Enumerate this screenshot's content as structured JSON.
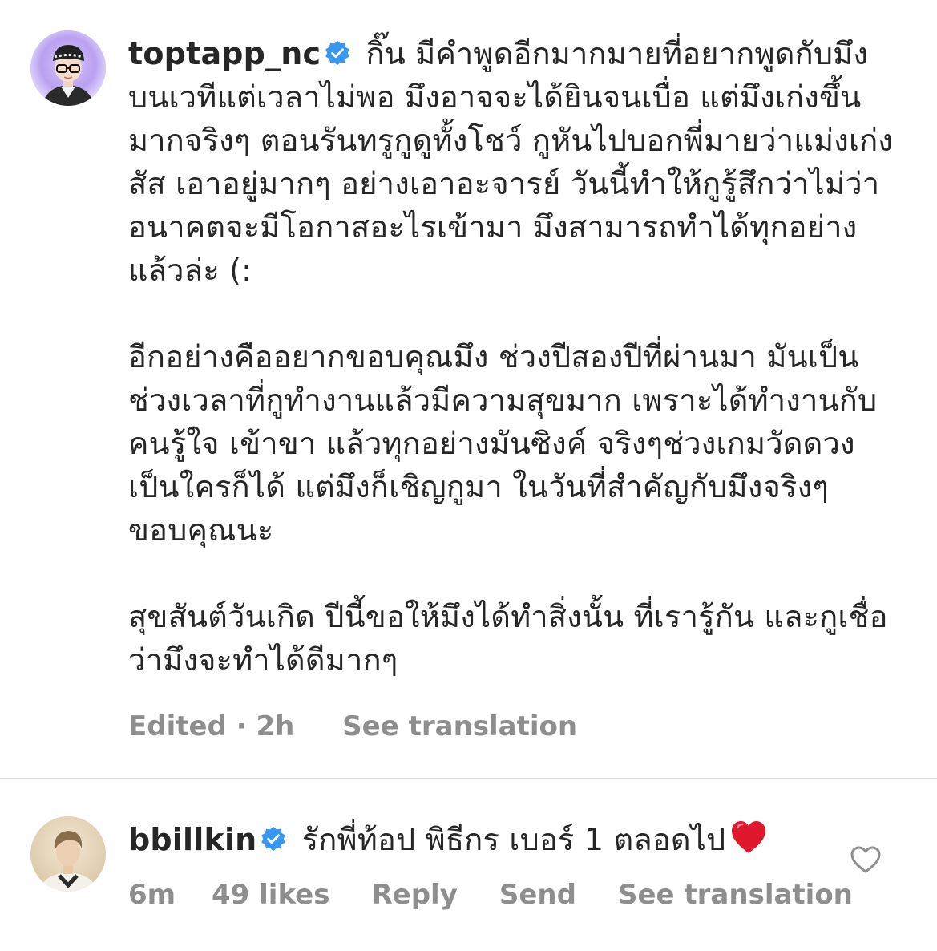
{
  "comments": [
    {
      "username": "toptapp_nc",
      "verified": true,
      "text": "กิ๊น มีคำพูดอีกมากมายที่อยากพูดกับมึงบนเวทีแต่เวลาไม่พอ มึงอาจจะได้ยินจนเบื่อ แต่มึงเก่งขึ้นมากจริงๆ ตอนรันทรูกูดูทั้งโชว์ กูหันไปบอกพี่มายว่าแม่งเก่งสัส เอาอยู่มากๆ อย่างเอาอะจารย์ วันนี้ทำให้กูรู้สึกว่าไม่ว่าอนาคตจะมีโอกาสอะไรเข้ามา มึงสามารถทำได้ทุกอย่างแล้วล่ะ (:\n\nอีกอย่างคืออยากขอบคุณมึง ช่วงปีสองปีที่ผ่านมา มันเป็นช่วงเวลาที่กูทำงานแล้วมีความสุขมาก เพราะได้ทำงานกับคนรู้ใจ เข้าขา แล้วทุกอย่างมันซิงค์ จริงๆช่วงเกมวัดดวงเป็นใครก็ได้ แต่มึงก็เชิญกูมา ในวันที่สำคัญกับมึงจริงๆขอบคุณนะ\n\nสุขสันต์วันเกิด ปีนี้ขอให้มึงได้ทำสิ่งนั้น ที่เรารู้กัน และกูเชื่อว่ามึงจะทำได้ดีมากๆ",
      "time": "Edited · 2h",
      "see_translation": "See translation"
    },
    {
      "username": "bbillkin",
      "verified": true,
      "text": "รักพี่ท้อป พิธีกร เบอร์ 1 ตลอดไป",
      "emoji": "heart",
      "time": "6m",
      "likes": "49 likes",
      "reply": "Reply",
      "send": "Send",
      "see_translation": "See translation"
    }
  ],
  "colors": {
    "text": "#262626",
    "meta": "#8e8e8e",
    "verified": "#3897f0",
    "divider": "#dbdbdb",
    "heart": "#e0182d"
  },
  "icons": {
    "verified": "verified-badge-icon",
    "like": "heart-outline-icon"
  }
}
